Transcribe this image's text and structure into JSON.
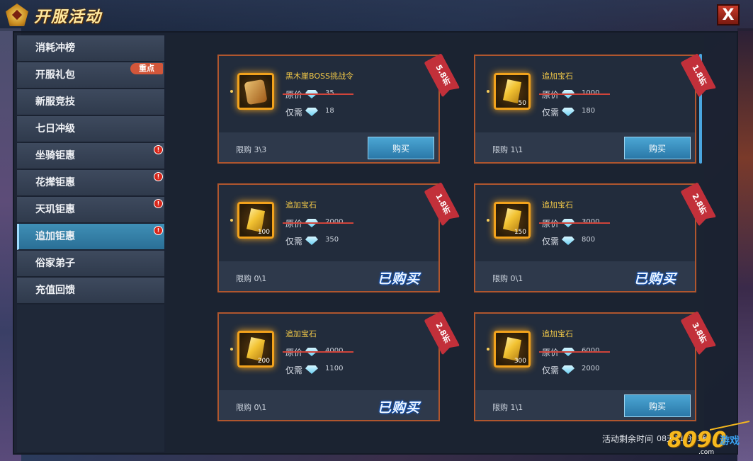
{
  "title": "开服活动",
  "close_label": "X",
  "sidebar": {
    "items": [
      {
        "label": "消耗冲榜",
        "active": false,
        "badge": ""
      },
      {
        "label": "开服礼包",
        "active": false,
        "badge": "重点"
      },
      {
        "label": "新服竞技",
        "active": false,
        "badge": ""
      },
      {
        "label": "七日冲级",
        "active": false,
        "badge": ""
      },
      {
        "label": "坐骑钜惠",
        "active": false,
        "badge": "!"
      },
      {
        "label": "花撵钜惠",
        "active": false,
        "badge": "!"
      },
      {
        "label": "天玑钜惠",
        "active": false,
        "badge": "!"
      },
      {
        "label": "追加钜惠",
        "active": true,
        "badge": "!"
      },
      {
        "label": "俗家弟子",
        "active": false,
        "badge": ""
      },
      {
        "label": "充值回馈",
        "active": false,
        "badge": ""
      }
    ]
  },
  "labels": {
    "original_price": "原价",
    "only_need": "仅需",
    "buy": "购买",
    "bought": "已购买"
  },
  "items": [
    {
      "name": "黑木崖BOSS挑战令",
      "icon": "token-icon",
      "count": "",
      "original": "35",
      "price": "18",
      "discount": "5.8折",
      "limit": "限购 3\\3",
      "status": "buy"
    },
    {
      "name": "追加宝石",
      "icon": "gem-icon",
      "count": "50",
      "original": "1000",
      "price": "180",
      "discount": "1.8折",
      "limit": "限购 1\\1",
      "status": "buy"
    },
    {
      "name": "追加宝石",
      "icon": "gem-icon",
      "count": "100",
      "original": "2000",
      "price": "350",
      "discount": "1.8折",
      "limit": "限购 0\\1",
      "status": "bought"
    },
    {
      "name": "追加宝石",
      "icon": "gem-icon",
      "count": "150",
      "original": "3000",
      "price": "800",
      "discount": "2.8折",
      "limit": "限购 0\\1",
      "status": "bought"
    },
    {
      "name": "追加宝石",
      "icon": "gem-icon",
      "count": "200",
      "original": "4000",
      "price": "1100",
      "discount": "2.8折",
      "limit": "限购 0\\1",
      "status": "bought"
    },
    {
      "name": "追加宝石",
      "icon": "gem-icon",
      "count": "300",
      "original": "6000",
      "price": "2000",
      "discount": "3.8折",
      "limit": "限购 1\\1",
      "status": "buy"
    }
  ],
  "footer": {
    "remaining_label": "活动剩余时间",
    "remaining_time": "08天11分03秒"
  },
  "watermark": {
    "number": "8090",
    "text": "游戏",
    "suffix": ".com"
  }
}
